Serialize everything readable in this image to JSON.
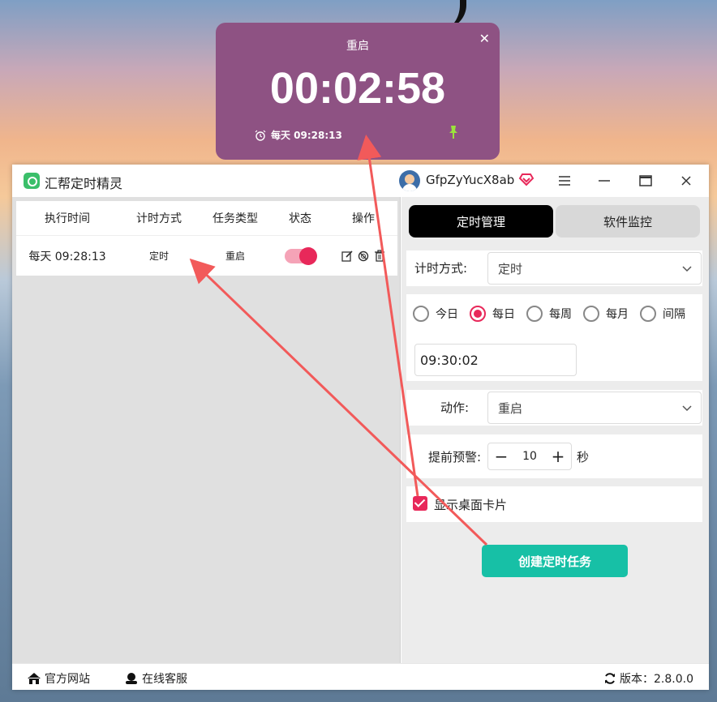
{
  "popup": {
    "title": "重启",
    "countdown": "00:02:58",
    "schedule": "每天 09:28:13"
  },
  "window": {
    "app_title": "汇帮定时精灵",
    "username": "GfpZyYucX8ab"
  },
  "task_table": {
    "columns": [
      "执行时间",
      "计时方式",
      "任务类型",
      "状态",
      "操作"
    ],
    "rows": [
      {
        "time": "每天 09:28:13",
        "method": "定时",
        "type": "重启",
        "enabled": true
      }
    ]
  },
  "right_panel": {
    "tabs": [
      "定时管理",
      "软件监控"
    ],
    "timing_label": "计时方式:",
    "timing_value": "定时",
    "frequency_options": [
      "今日",
      "每日",
      "每周",
      "每月",
      "间隔"
    ],
    "frequency_selected": "每日",
    "time_value": "09:30:02",
    "action_label": "动作:",
    "action_value": "重启",
    "warning_label": "提前预警:",
    "warning_value": "10",
    "warning_unit": "秒",
    "show_card_label": "显示桌面卡片",
    "create_button": "创建定时任务"
  },
  "footer": {
    "website": "官方网站",
    "support": "在线客服",
    "version": "版本：2.8.0.0"
  },
  "colors": {
    "accent": "#e8285a",
    "primary_button": "#17c0a6",
    "popup_bg": "#8e5283",
    "arrow": "#f25a5a"
  }
}
